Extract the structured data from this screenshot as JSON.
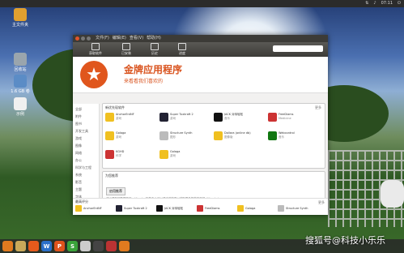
{
  "topbar": {
    "clock": "07:11"
  },
  "desktop_icons": [
    {
      "label": "主文件夹",
      "color": "#e0a030"
    },
    {
      "label": "回收站",
      "color": "#9aa5ad"
    },
    {
      "label": "1.6 GB 卷",
      "color": "#5b8cc6"
    },
    {
      "label": "示例",
      "color": "#f0f0f0"
    }
  ],
  "window": {
    "menu": [
      "文件(F)",
      "编辑(E)",
      "查看(V)",
      "帮助(H)"
    ],
    "toolbar": [
      {
        "label": "获取软件",
        "icon": "download-icon"
      },
      {
        "label": "已安装",
        "icon": "monitor-icon"
      },
      {
        "label": "历史",
        "icon": "clock-icon"
      },
      {
        "label": "进度",
        "icon": "progress-icon"
      }
    ],
    "search_placeholder": "",
    "banner": {
      "title": "金牌应用程序",
      "subtitle": "来看看我们喜欢的"
    },
    "sidebar": [
      "全部",
      "附件",
      "图书",
      "开发工具",
      "游戏",
      "图像",
      "网络",
      "办公",
      "科学与工程",
      "系统",
      "影音",
      "主题",
      "字体",
      "教育",
      "通用",
      "软件包"
    ],
    "featured": {
      "title": "新优先现软件",
      "more": "更多",
      "apps": [
        {
          "name": "AnchorEntNF",
          "sub": "游戏",
          "color": "#f0c020"
        },
        {
          "name": "Super Tuxkraft 2",
          "sub": "游戏",
          "color": "#223"
        },
        {
          "name": "JACK 对待轻松",
          "sub": "音乐",
          "color": "#111"
        },
        {
          "name": "FreeDiams",
          "sub": "Medicine",
          "color": "#cc3333"
        },
        {
          "name": "Golaga",
          "sub": "游戏",
          "color": "#f0c020"
        },
        {
          "name": "Structure Synth",
          "sub": "图形",
          "color": "#bbbbbb"
        },
        {
          "name": "Dollara (online db)",
          "sub": "图像版",
          "color": "#f0c020"
        },
        {
          "name": "Webcontrol",
          "sub": "音乐",
          "color": "#117711"
        },
        {
          "name": "KGHD",
          "sub": "科学",
          "color": "#cc3333"
        },
        {
          "name": "Golaga",
          "sub": "游戏",
          "color": "#f0c020"
        }
      ]
    },
    "recommend": {
      "title": "为您推荐",
      "button": "启用推荐",
      "text": "减少重复的数据费用，Ubuntu 软件中心可以通过浏览器以获取更多推荐的软件 (Ubuntu)"
    },
    "bottom": {
      "title": "最高评分",
      "more": "更多",
      "apps": [
        {
          "name": "AnchorEntNF",
          "color": "#f0c020"
        },
        {
          "name": "Super Tuxkraft 2",
          "color": "#223"
        },
        {
          "name": "JACK 对待轻松",
          "color": "#111"
        },
        {
          "name": "FreeDiams",
          "color": "#cc3333"
        },
        {
          "name": "Golaga",
          "color": "#f0c020"
        },
        {
          "name": "Structure Synth",
          "color": "#bbbbbb"
        }
      ]
    }
  },
  "dock": [
    {
      "label": "",
      "color": "#e07a1f",
      "icon": "ubuntu-logo-icon"
    },
    {
      "label": "",
      "color": "#c9a95a",
      "icon": "files-icon"
    },
    {
      "label": "",
      "color": "#e65a1c",
      "icon": "firefox-icon"
    },
    {
      "label": "W",
      "color": "#2b6fc9",
      "icon": "writer-icon"
    },
    {
      "label": "P",
      "color": "#e0531c",
      "icon": "impress-icon"
    },
    {
      "label": "S",
      "color": "#3aa33a",
      "icon": "calc-icon"
    },
    {
      "label": "",
      "color": "#cccccc",
      "icon": "disk-icon"
    },
    {
      "label": "",
      "color": "#444444",
      "icon": "terminal-icon"
    },
    {
      "label": "",
      "color": "#bb3333",
      "icon": "software-center-icon"
    },
    {
      "label": "",
      "color": "#e07a1f",
      "icon": "package-icon"
    }
  ],
  "watermark": "搜狐号@科技小乐乐"
}
